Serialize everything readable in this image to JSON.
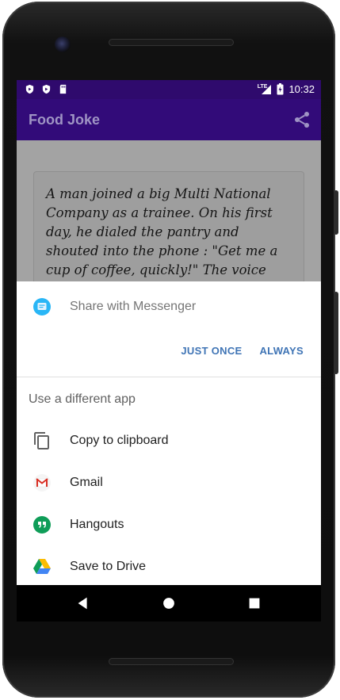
{
  "status_bar": {
    "time": "10:32",
    "network_label": "LTE",
    "icons": [
      "shield-icon",
      "shield-icon",
      "sd-card-icon",
      "signal-icon",
      "battery-icon"
    ]
  },
  "app_bar": {
    "title": "Food Joke",
    "share_icon": "share-icon"
  },
  "joke": {
    "text": "A man joined a big Multi National Company as a trainee. On his first day, he dialed the pantry and shouted into the phone : \"Get me a cup of coffee, quickly!\" The voice from the other side responded :"
  },
  "share_sheet": {
    "preferred": {
      "label": "Share with Messenger",
      "icon": "messenger-icon"
    },
    "actions": {
      "just_once": "JUST ONCE",
      "always": "ALWAYS"
    },
    "subheader": "Use a different app",
    "apps": [
      {
        "label": "Copy to clipboard",
        "icon": "copy-icon"
      },
      {
        "label": "Gmail",
        "icon": "gmail-icon"
      },
      {
        "label": "Hangouts",
        "icon": "hangouts-icon"
      },
      {
        "label": "Save to Drive",
        "icon": "drive-icon"
      }
    ]
  },
  "nav_bar": {
    "icons": [
      "back-icon",
      "home-icon",
      "recents-icon"
    ]
  },
  "colors": {
    "status_bar": "#2f0a6d",
    "app_bar": "#320b79",
    "accent": "#3f74b5"
  }
}
